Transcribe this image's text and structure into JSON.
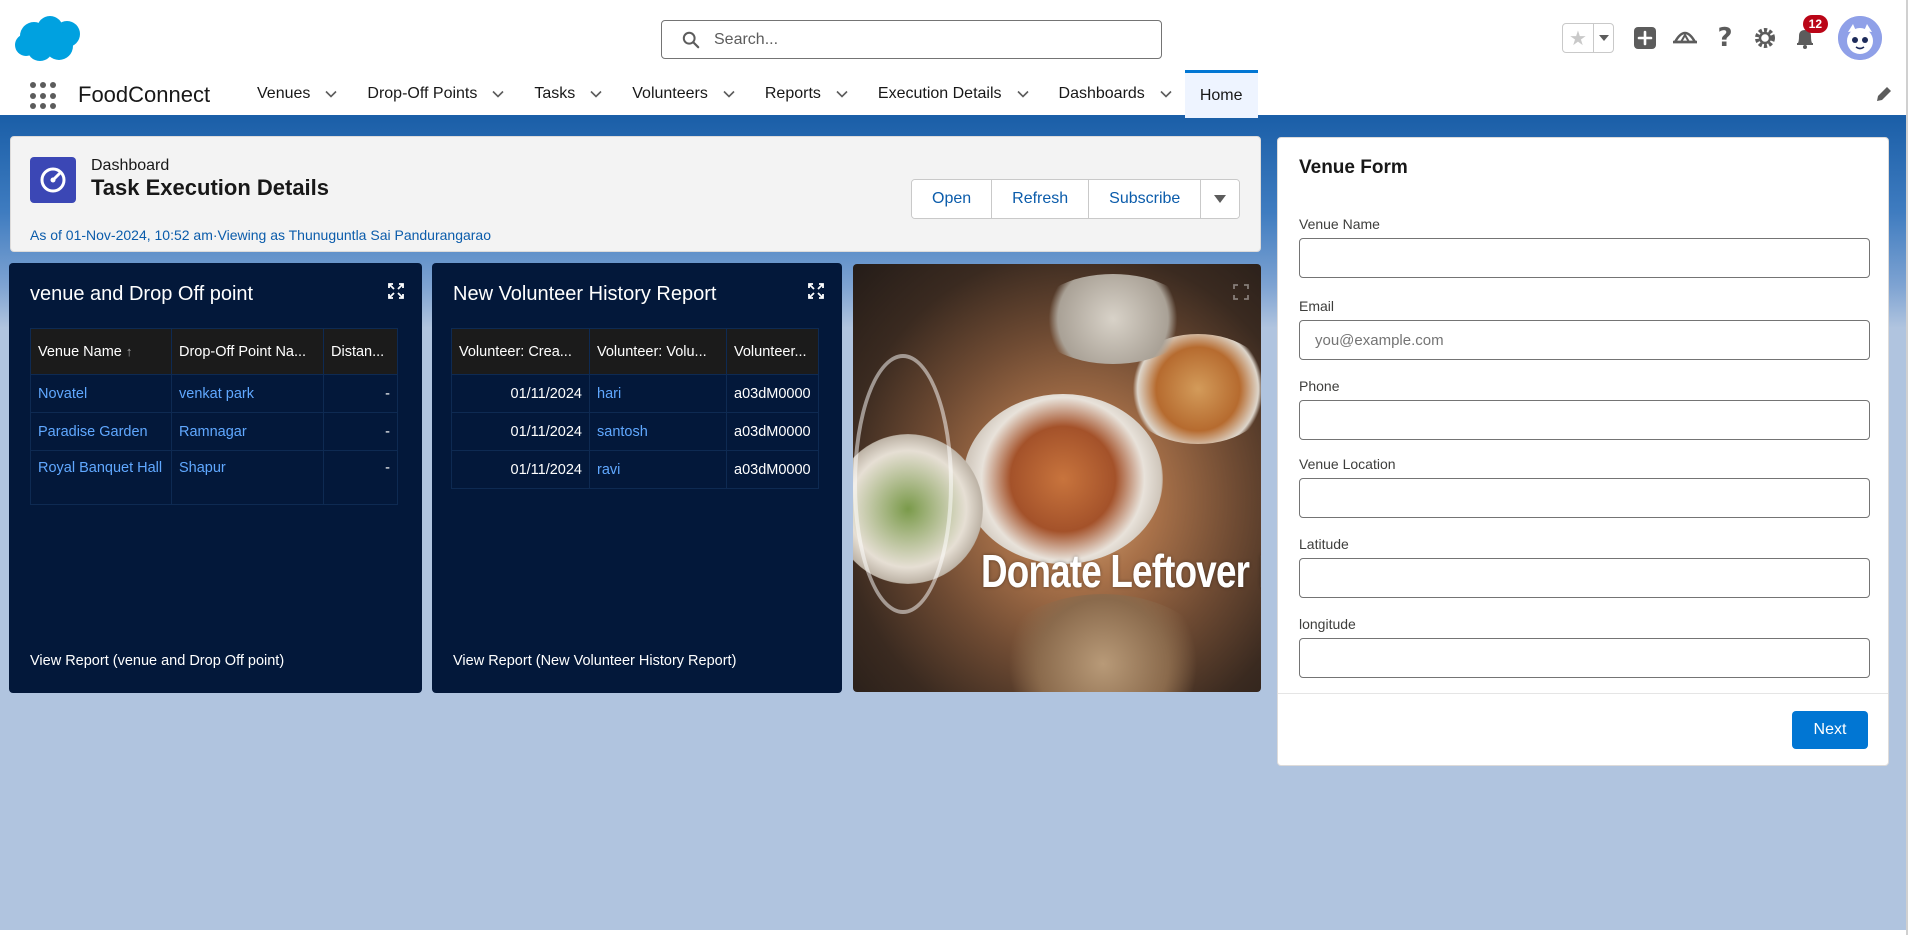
{
  "header": {
    "search_placeholder": "Search...",
    "notification_count": "12"
  },
  "nav": {
    "app_name": "FoodConnect",
    "items": [
      {
        "label": "Venues"
      },
      {
        "label": "Drop-Off Points"
      },
      {
        "label": "Tasks"
      },
      {
        "label": "Volunteers"
      },
      {
        "label": "Reports"
      },
      {
        "label": "Execution Details"
      },
      {
        "label": "Dashboards"
      }
    ],
    "active_item": "Home"
  },
  "dashboard": {
    "type_label": "Dashboard",
    "title": "Task Execution Details",
    "meta": "As of 01-Nov-2024, 10:52 am·Viewing as Thunuguntla Sai Pandurangarao",
    "buttons": {
      "open": "Open",
      "refresh": "Refresh",
      "subscribe": "Subscribe"
    }
  },
  "widget1": {
    "title": "venue and Drop Off point",
    "columns": [
      "Venue Name",
      "Drop-Off Point Na...",
      "Distan..."
    ],
    "rows": [
      {
        "venue": "Novatel",
        "dropoff": "venkat park",
        "distance": "-"
      },
      {
        "venue": "Paradise Garden",
        "dropoff": "Ramnagar",
        "distance": "-"
      },
      {
        "venue": "Royal Banquet Hall",
        "dropoff": "Shapur",
        "distance": "-"
      }
    ],
    "view_report": "View Report (venue and Drop Off point)"
  },
  "widget2": {
    "title": "New Volunteer History Report",
    "columns": [
      "Volunteer: Crea...",
      "Volunteer: Volu...",
      "Volunteer..."
    ],
    "rows": [
      {
        "date": "01/11/2024",
        "name": "hari",
        "id": "a03dM0000"
      },
      {
        "date": "01/11/2024",
        "name": "santosh",
        "id": "a03dM0000"
      },
      {
        "date": "01/11/2024",
        "name": "ravi",
        "id": "a03dM0000"
      }
    ],
    "view_report": "View Report (New Volunteer History Report)"
  },
  "image_widget": {
    "caption": "Donate Leftover Food"
  },
  "venue_form": {
    "title": "Venue Form",
    "fields": {
      "venue_name": {
        "label": "Venue Name",
        "value": "",
        "placeholder": ""
      },
      "email": {
        "label": "Email",
        "value": "",
        "placeholder": "you@example.com"
      },
      "phone": {
        "label": "Phone",
        "value": "",
        "placeholder": ""
      },
      "venue_location": {
        "label": "Venue Location",
        "value": "",
        "placeholder": ""
      },
      "latitude": {
        "label": "Latitude",
        "value": "",
        "placeholder": ""
      },
      "longitude": {
        "label": "longitude",
        "value": "",
        "placeholder": ""
      }
    },
    "next_label": "Next"
  },
  "colors": {
    "brand_blue": "#0176d3",
    "widget_bg": "#03183a",
    "link_blue": "#60a8ff",
    "dashboard_icon": "#3b47b5",
    "badge_red": "#ba0517"
  },
  "icons": [
    "salesforce-cloud-logo",
    "search-icon",
    "star-icon",
    "add-icon",
    "trailhead-icon",
    "help-icon",
    "gear-icon",
    "bell-icon",
    "avatar",
    "app-launcher-icon",
    "chevron-down-icon",
    "pencil-icon",
    "dashboard-gauge-icon",
    "expand-icon"
  ]
}
